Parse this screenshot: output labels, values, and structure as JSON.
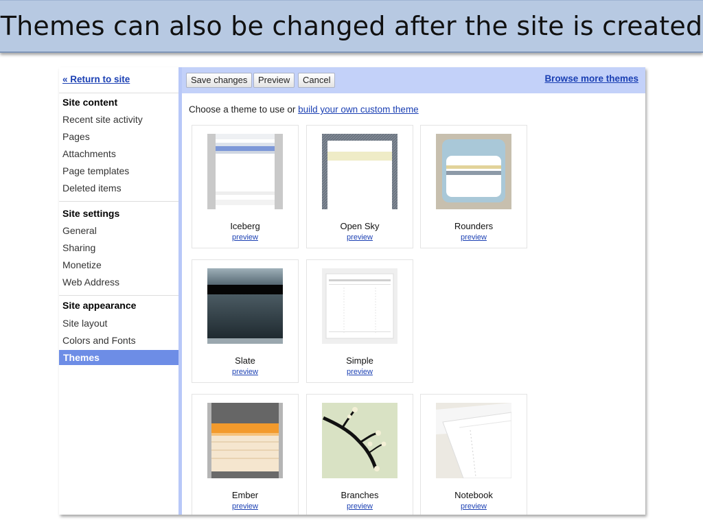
{
  "slide": {
    "title": "Themes can also be changed after the site is created"
  },
  "sidebar": {
    "return_link": "« Return to site",
    "sections": [
      {
        "heading": "Site content",
        "items": [
          "Recent site activity",
          "Pages",
          "Attachments",
          "Page templates",
          "Deleted items"
        ]
      },
      {
        "heading": "Site settings",
        "items": [
          "General",
          "Sharing",
          "Monetize",
          "Web Address"
        ]
      },
      {
        "heading": "Site appearance",
        "items": [
          "Site layout",
          "Colors and Fonts",
          "Themes"
        ]
      }
    ],
    "active_item": "Themes",
    "active_color": "#6d8de6"
  },
  "toolbar": {
    "save_label": "Save changes",
    "preview_label": "Preview",
    "cancel_label": "Cancel",
    "browse_label": "Browse more themes"
  },
  "main": {
    "choose_text": "Choose a theme to use or",
    "custom_link": "build your own custom theme"
  },
  "themes": [
    {
      "name": "Iceberg",
      "preview": "preview"
    },
    {
      "name": "Open Sky",
      "preview": "preview"
    },
    {
      "name": "Rounders",
      "preview": "preview"
    },
    {
      "name": "Slate",
      "preview": "preview"
    },
    {
      "name": "Simple",
      "preview": "preview"
    },
    {
      "name": "Ember",
      "preview": "preview"
    },
    {
      "name": "Branches",
      "preview": "preview"
    },
    {
      "name": "Notebook",
      "preview": "preview"
    }
  ]
}
